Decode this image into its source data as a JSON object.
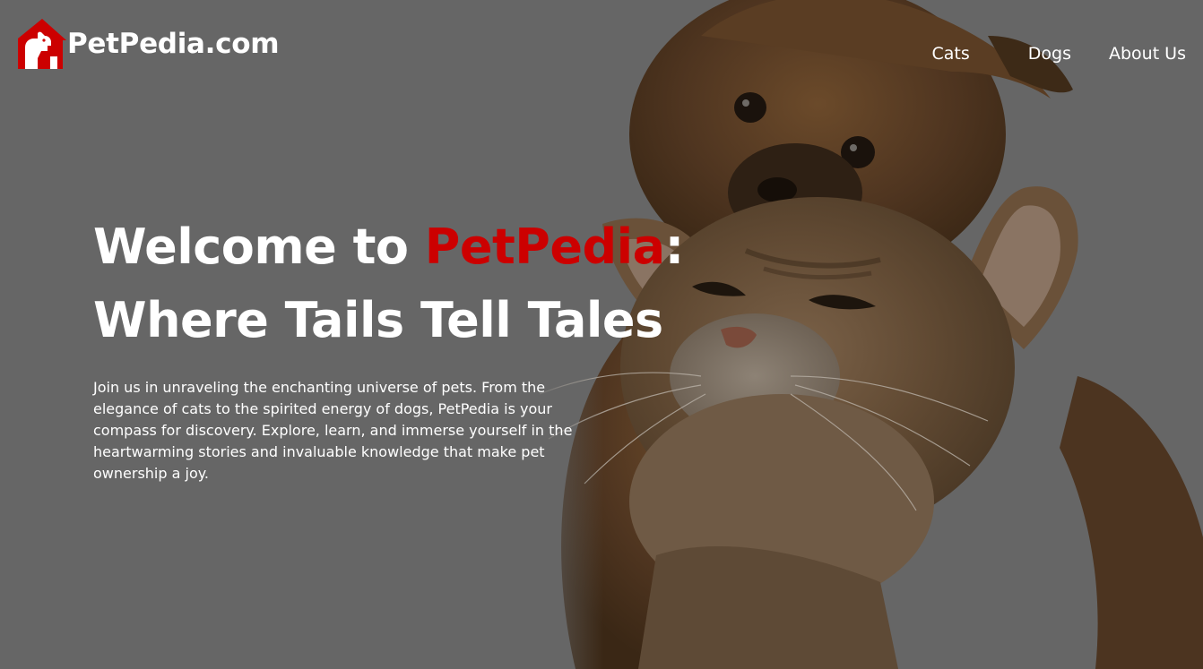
{
  "brand": {
    "name": "PetPedia.com",
    "logo_icon": "house-dog-logo-icon",
    "accent_color": "#cc0000"
  },
  "nav": {
    "items": [
      {
        "label": "Cats"
      },
      {
        "label": "Dogs"
      },
      {
        "label": "About Us"
      }
    ]
  },
  "hero": {
    "title_prefix": "Welcome to ",
    "title_accent": "PetPedia",
    "title_colon": ":",
    "title_line2": "Where Tails Tell Tales",
    "description": "Join us in unraveling the enchanting universe of pets. From the elegance of cats to the spirited energy of dogs, PetPedia is your compass for discovery. Explore, learn, and immerse yourself in the heartwarming stories and invaluable knowledge that make pet ownership a joy.",
    "image": "puppy-and-kitten-photo",
    "overlay_color": "#666666"
  }
}
